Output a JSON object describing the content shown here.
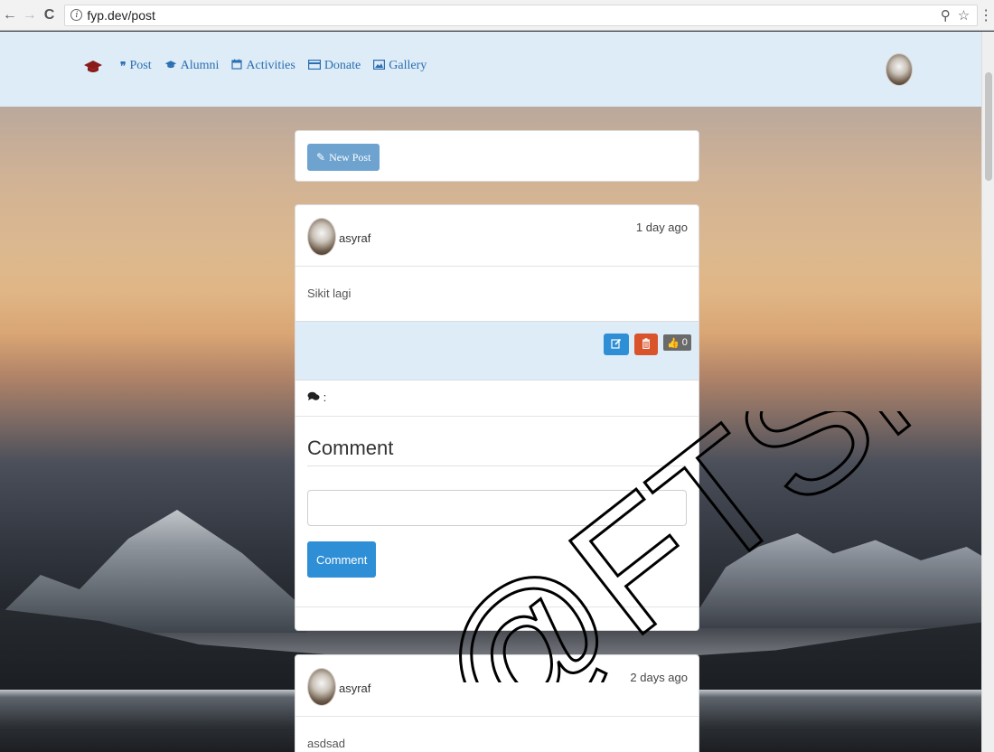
{
  "browser": {
    "back_icon": "←",
    "forward_icon": "→",
    "reload_icon": "C",
    "info_icon": "i",
    "url": "fyp.dev/post",
    "key_icon": "⚲",
    "star_icon": "☆",
    "menu_icon": "⋮"
  },
  "navbar": {
    "brand_icon": "graduation-cap-icon",
    "items": [
      {
        "label": "Post",
        "icon": "quote-icon",
        "glyph": "❞"
      },
      {
        "label": "Alumni",
        "icon": "graduation-cap-icon",
        "glyph": "🎓"
      },
      {
        "label": "Activities",
        "icon": "calendar-icon",
        "glyph": "📅"
      },
      {
        "label": "Donate",
        "icon": "credit-card-icon",
        "glyph": "▭"
      },
      {
        "label": "Gallery",
        "icon": "picture-icon",
        "glyph": "🖼"
      }
    ]
  },
  "new_post": {
    "label": "New Post",
    "icon": "pencil-icon",
    "glyph": "✎"
  },
  "posts": [
    {
      "user": "asyraf",
      "time": "1 day ago",
      "body": "Sikit lagi",
      "likes": "0",
      "comments_label": ":",
      "comment_heading": "Comment",
      "comment_placeholder": "",
      "comment_button": "Comment"
    },
    {
      "user": "asyraf",
      "time": "2 days ago",
      "body": "asdsad"
    }
  ],
  "watermark": "@FTSM",
  "colors": {
    "navbar_bg": "#ddecf7",
    "link": "#2b6fb3",
    "primary_button": "#2f8fd6",
    "danger_button": "#d9532b",
    "new_post_button": "#6ea3cf"
  }
}
